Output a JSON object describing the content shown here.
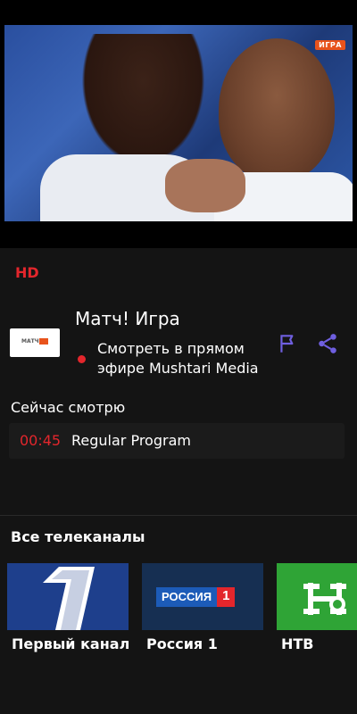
{
  "player": {
    "watermark": "ИГРА"
  },
  "quality_badge": "HD",
  "channel": {
    "logo_text": "МАТЧ",
    "title": "Матч! Игра",
    "live_text": "Смотреть в прямом эфире Mushtari Media"
  },
  "actions": {
    "flag_icon": "flag-icon",
    "share_icon": "share-icon"
  },
  "now_watching": {
    "label": "Сейчас смотрю",
    "program": {
      "time": "00:45",
      "title": "Regular Program"
    }
  },
  "all_channels": {
    "label": "Все телеканалы",
    "items": [
      {
        "name": "Первый канал"
      },
      {
        "name": "Россия 1",
        "logo_word": "РОССИЯ",
        "logo_num": "1"
      },
      {
        "name": "НТВ"
      }
    ]
  },
  "colors": {
    "accent": "#e3262c",
    "icon_purple": "#6f5fe0",
    "background": "#141414"
  }
}
